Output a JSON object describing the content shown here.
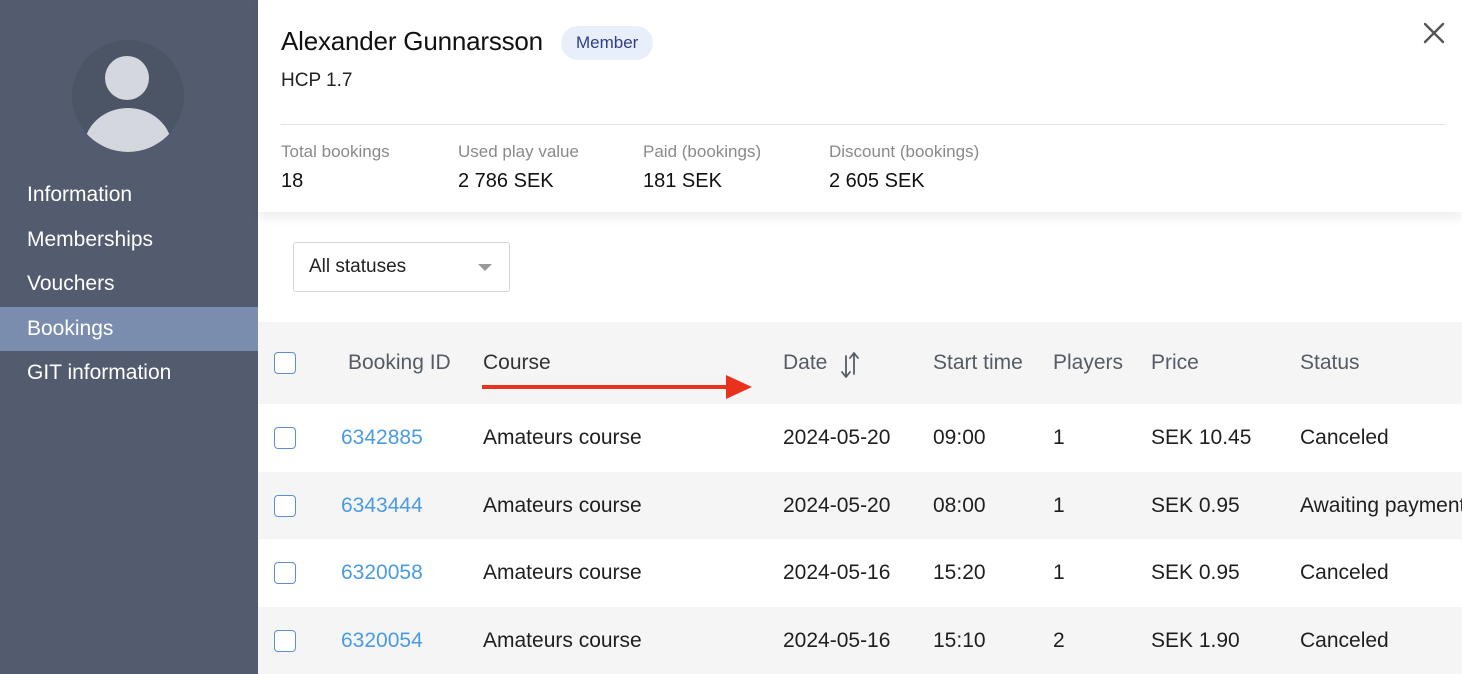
{
  "sidebar": {
    "items": [
      {
        "label": "Information",
        "active": false
      },
      {
        "label": "Memberships",
        "active": false
      },
      {
        "label": "Vouchers",
        "active": false
      },
      {
        "label": "Bookings",
        "active": true
      },
      {
        "label": "GIT information",
        "active": false
      }
    ]
  },
  "profile": {
    "name": "Alexander Gunnarsson",
    "badge": "Member",
    "hcp": "HCP 1.7"
  },
  "stats": [
    {
      "label": "Total bookings",
      "value": "18"
    },
    {
      "label": "Used play value",
      "value": "2 786 SEK"
    },
    {
      "label": "Paid (bookings)",
      "value": "181 SEK"
    },
    {
      "label": "Discount (bookings)",
      "value": "2 605 SEK"
    }
  ],
  "filter": {
    "selected": "All statuses"
  },
  "table": {
    "columns": [
      "Booking ID",
      "Course",
      "Date",
      "Start time",
      "Players",
      "Price",
      "Status"
    ],
    "rows": [
      {
        "id": "6342885",
        "course": "Amateurs course",
        "date": "2024-05-20",
        "start": "09:00",
        "players": "1",
        "price": "SEK 10.45",
        "status": "Canceled"
      },
      {
        "id": "6343444",
        "course": "Amateurs course",
        "date": "2024-05-20",
        "start": "08:00",
        "players": "1",
        "price": "SEK 0.95",
        "status": "Awaiting payment"
      },
      {
        "id": "6320058",
        "course": "Amateurs course",
        "date": "2024-05-16",
        "start": "15:20",
        "players": "1",
        "price": "SEK 0.95",
        "status": "Canceled"
      },
      {
        "id": "6320054",
        "course": "Amateurs course",
        "date": "2024-05-16",
        "start": "15:10",
        "players": "2",
        "price": "SEK 1.90",
        "status": "Canceled"
      }
    ]
  },
  "colors": {
    "sidebar": "#525c6e",
    "sidebar_active": "#7b8daf",
    "link": "#4a9be0",
    "badge_bg": "#e9eefb",
    "annotation_arrow": "#e8321e"
  },
  "icons": {
    "close": "close-icon",
    "sort": "sort-arrows-icon",
    "dropdown": "caret-down-icon",
    "avatar": "user-avatar-icon"
  }
}
